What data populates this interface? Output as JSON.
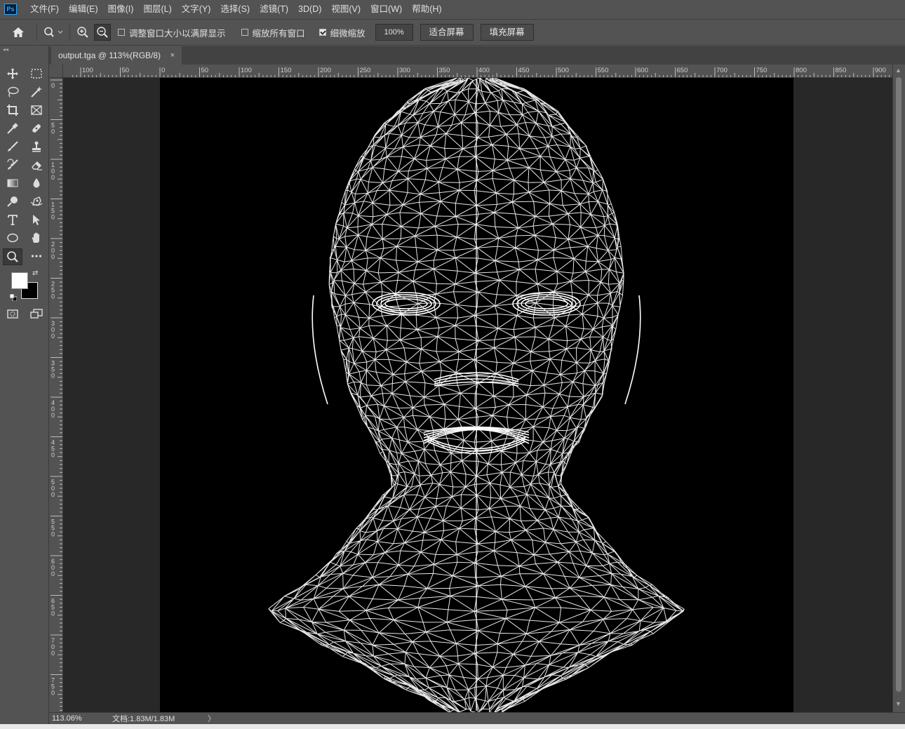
{
  "app": {
    "logo": "Ps"
  },
  "menu": [
    "文件(F)",
    "编辑(E)",
    "图像(I)",
    "图层(L)",
    "文字(Y)",
    "选择(S)",
    "滤镜(T)",
    "3D(D)",
    "视图(V)",
    "窗口(W)",
    "帮助(H)"
  ],
  "options": {
    "resize_windows_label": "调整窗口大小以满屏显示",
    "resize_windows_checked": false,
    "zoom_all_windows_label": "缩放所有窗口",
    "zoom_all_windows_checked": false,
    "scrubby_zoom_label": "细微缩放",
    "scrubby_zoom_checked": true,
    "zoom_value": "100%",
    "fit_screen_label": "适合屏幕",
    "fill_screen_label": "填充屏幕"
  },
  "document": {
    "tab_title": "output.tga @ 113%(RGB/8)",
    "close_glyph": "×"
  },
  "rulers": {
    "horizontal": [
      "100",
      "50",
      "0",
      "50",
      "100",
      "150",
      "200",
      "250",
      "300",
      "350",
      "400",
      "450",
      "500",
      "550",
      "600",
      "650",
      "700",
      "750",
      "800",
      "850",
      "900"
    ],
    "vertical": [
      "0",
      "50",
      "100",
      "150",
      "200",
      "250",
      "300",
      "350",
      "400",
      "450",
      "500",
      "550",
      "600",
      "650",
      "700",
      "750"
    ]
  },
  "status": {
    "zoom": "113.06%",
    "doc_info": "文档:1.83M/1.83M",
    "arrow": "〉"
  },
  "tools": [
    "move-icon",
    "marquee-icon",
    "lasso-icon",
    "magic-wand-icon",
    "crop-icon",
    "frame-icon",
    "eyedropper-icon",
    "healing-brush-icon",
    "brush-icon",
    "clone-stamp-icon",
    "history-brush-icon",
    "eraser-icon",
    "gradient-icon",
    "blur-icon",
    "dodge-icon",
    "pen-icon",
    "type-icon",
    "path-select-icon",
    "ellipse-icon",
    "hand-icon",
    "zoom-icon",
    "more-icon",
    "quick-mask-icon",
    "screen-mode-icon"
  ],
  "colors": {
    "foreground": "#ffffff",
    "background": "#000000",
    "wireframe": "#ffffff"
  }
}
